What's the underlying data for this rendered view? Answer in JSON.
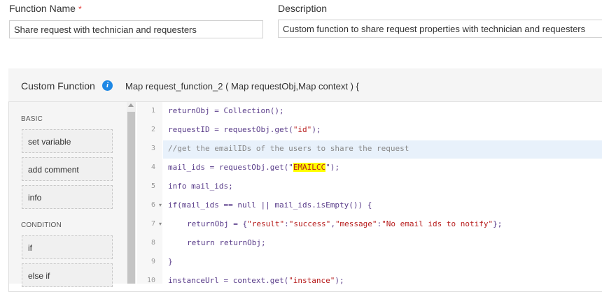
{
  "form": {
    "function_name_label": "Function Name",
    "required_mark": "*",
    "function_name_value": "Share request with technician and requesters",
    "description_label": "Description",
    "description_value": "Custom function to share request properties with technician and requesters"
  },
  "panel": {
    "title": "Custom Function",
    "info_icon": "info-icon",
    "signature": "Map request_function_2 ( Map requestObj,Map context ) {"
  },
  "sidebar": {
    "basic_label": "BASIC",
    "basic_items": [
      "set variable",
      "add comment",
      "info"
    ],
    "condition_label": "CONDITION",
    "condition_items": [
      "if",
      "else if"
    ]
  },
  "editor": {
    "line_numbers": [
      "1",
      "2",
      "3",
      "4",
      "5",
      "6",
      "7",
      "8",
      "9",
      "10"
    ],
    "lines": {
      "l1": "returnObj = Collection();",
      "l2a": "requestID = requestObj.get(",
      "l2b": "\"id\"",
      "l2c": ");",
      "l3": "//get the emailIDs of the users to share the request",
      "l4a": "mail_ids = requestObj.get(\"",
      "l4b": "EMAILCC",
      "l4c": "\");",
      "l5": "info mail_ids;",
      "l6": "if(mail_ids == null || mail_ids.isEmpty()) {",
      "l7a": "returnObj = {",
      "l7b": "\"result\"",
      "l7c": ":",
      "l7d": "\"success\"",
      "l7e": ",",
      "l7f": "\"message\"",
      "l7g": ":",
      "l7h": "\"No email ids to notify\"",
      "l7i": "};",
      "l8": "return returnObj;",
      "l9": "}",
      "l10a": "instanceUrl = context.get(",
      "l10b": "\"instance\"",
      "l10c": ");"
    }
  }
}
